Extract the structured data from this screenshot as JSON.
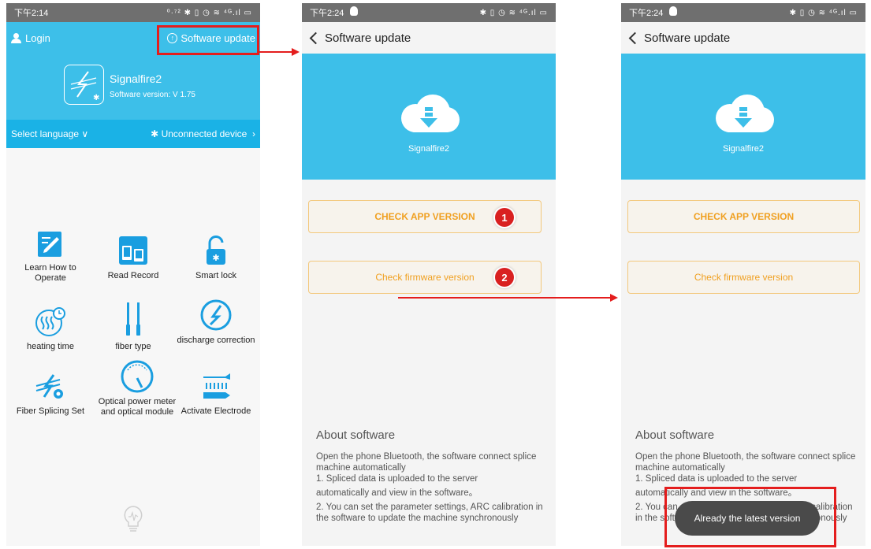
{
  "screen1": {
    "status": {
      "time": "下午2:14",
      "icons": "⁰·⁷² ✱ ▯ ◷ ≋ ⁴ᴳ.ıl ▭"
    },
    "login": "Login",
    "software_update": "Software update",
    "app_name": "Signalfire2",
    "software_version": "Software version: V 1.75",
    "select_language": "Select language",
    "device_status": "Unconnected device",
    "menu": [
      {
        "label": "Learn How to Operate",
        "icon": "edit-icon"
      },
      {
        "label": "Read Record",
        "icon": "tablet-icon"
      },
      {
        "label": "Smart lock",
        "icon": "lock-icon"
      },
      {
        "label": "heating time",
        "icon": "heating-icon"
      },
      {
        "label": "fiber type",
        "icon": "fiber-icon"
      },
      {
        "label": "discharge correction",
        "icon": "discharge-icon"
      },
      {
        "label": "Fiber Splicing Set",
        "icon": "splicing-settings-icon"
      },
      {
        "label": "Optical power meter and optical module",
        "icon": "gauge-icon"
      },
      {
        "label": "Activate Electrode",
        "icon": "electrode-icon"
      }
    ]
  },
  "screen2": {
    "status": {
      "time": "下午2:24",
      "icons": "✱ ▯ ◷ ≋ ⁴ᴳ.ıl ▭"
    },
    "title": "Software update",
    "app_name": "Signalfire2",
    "check_app": "CHECK APP VERSION",
    "check_firmware": "Check firmware version",
    "badge1": "1",
    "badge2": "2",
    "about_title": "About software",
    "about_lines": [
      "Open the phone Bluetooth, the software connect splice machine automatically",
      "1. Spliced data is uploaded to the server",
      "automatically and view in the software。",
      "2. You can set the parameter settings, ARC calibration in the software to update the machine synchronously"
    ]
  },
  "screen3": {
    "status": {
      "time": "下午2:24",
      "icons": "✱ ▯ ◷ ≋ ⁴ᴳ.ıl ▭"
    },
    "title": "Software update",
    "app_name": "Signalfire2",
    "check_app": "CHECK APP VERSION",
    "check_firmware": "Check firmware version",
    "about_title": "About software",
    "about_lines": [
      "Open the phone Bluetooth, the software connect splice machine automatically",
      "1. Spliced data is uploaded to the server",
      "automatically and view in the software。",
      "2. You can set the parameter settings, ARC calibration in the software to update the machine synchronously"
    ],
    "toast": "Already the latest version"
  },
  "colors": {
    "header_blue": "#3dbfe9",
    "bar_blue": "#1ab2e6",
    "icon_blue": "#1a9ee0",
    "button_orange": "#f0a021",
    "highlight_red": "#e41d1d",
    "toast_bg": "#4a4a4a"
  }
}
